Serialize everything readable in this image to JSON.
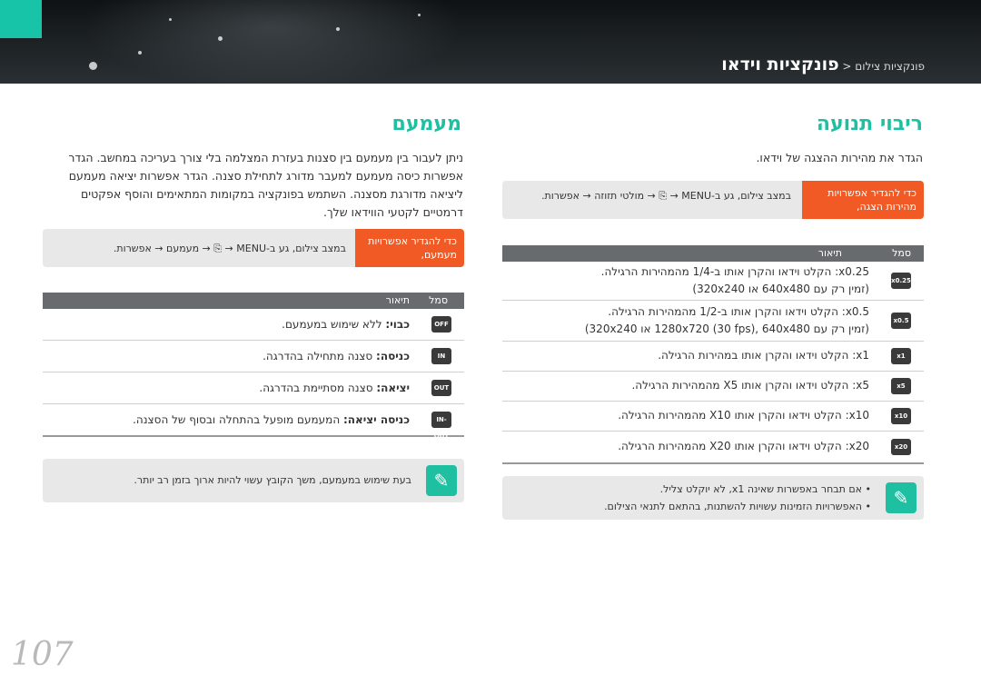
{
  "breadcrumb": {
    "parent": "פונקציות צילום",
    "separator": " < ",
    "current": "פונקציות וידאו"
  },
  "left_section": {
    "title": "ריבוי תנועה",
    "desc": "הגדר את מהירות ההצגה של וידאו.",
    "nav": {
      "orange": "כדי להגדיר אפשרויות מהירות הצגה,",
      "path": "במצב צילום, גע ב-MENU → ⎘ → מולטי תזוזה → אפשרות."
    },
    "table": {
      "headers": [
        "סמל",
        "תיאור"
      ],
      "rows": [
        {
          "icon": "x0.25",
          "line1": "x0.25: הקלט וידאו והקרן אותו ב-1/4 מהמהירות הרגילה.",
          "line2": "(זמין רק עם 640x480 או 320x240)"
        },
        {
          "icon": "x0.5",
          "line1": "x0.5: הקלט וידאו והקרן אותו ב-1/2 מהמהירות הרגילה.",
          "line2": "(זמין רק עם 1280x720 (30 fps), 640x480 או 320x240)"
        },
        {
          "icon": "x1",
          "line1": "x1: הקלט וידאו והקרן אותו במהירות הרגילה.",
          "line2": ""
        },
        {
          "icon": "x5",
          "line1": "x5: הקלט וידאו והקרן אותו X5 מהמהירות הרגילה.",
          "line2": ""
        },
        {
          "icon": "x10",
          "line1": "x10: הקלט וידאו והקרן אותו X10 מהמהירות הרגילה.",
          "line2": ""
        },
        {
          "icon": "x20",
          "line1": "x20: הקלט וידאו והקרן אותו X20 מהמהירות הרגילה.",
          "line2": ""
        }
      ]
    },
    "notes": [
      "אם תבחר באפשרות שאינה x1, לא יוקלט צליל.",
      "האפשרויות הזמינות עשויות להשתנות, בהתאם לתנאי הצילום."
    ]
  },
  "right_section": {
    "title": "מעמעם",
    "desc": "ניתן לעבור בין מעמעם בין סצנות בעזרת המצלמה בלי צורך בעריכה במחשב. הגדר אפשרות כיסה מעמעם למעבר מדורג לתחילת סצנה. הגדר אפשרות יציאה מעמעם ליציאה מדורגת מסצנה. השתמש בפונקציה במקומות המתאימים והוסף אפקטים דרמטיים לקטעי הווידאו שלך.",
    "nav": {
      "orange": "כדי להגדיר אפשרויות מעמעם,",
      "path": "במצב צילום, גע ב-MENU → ⎘ → מעמעם → אפשרות."
    },
    "table": {
      "headers": [
        "סמל",
        "תיאור"
      ],
      "rows": [
        {
          "icon": "OFF",
          "bold": "כבוי:",
          "text": " ללא שימוש במעמעם."
        },
        {
          "icon": "IN",
          "bold": "כניסה:",
          "text": " סצנה מתחילה בהדרגה."
        },
        {
          "icon": "OUT",
          "bold": "יציאה:",
          "text": " סצנה מסתיימת בהדרגה."
        },
        {
          "icon": "IN-OUT",
          "bold": "כניסה יציאה:",
          "text": " המעמעם מופעל בהתחלה ובסוף של הסצנה."
        }
      ]
    },
    "note": "בעת שימוש במעמעם, משך הקובץ עשוי להיות ארוך בזמן רב יותר."
  },
  "page_number": "107"
}
